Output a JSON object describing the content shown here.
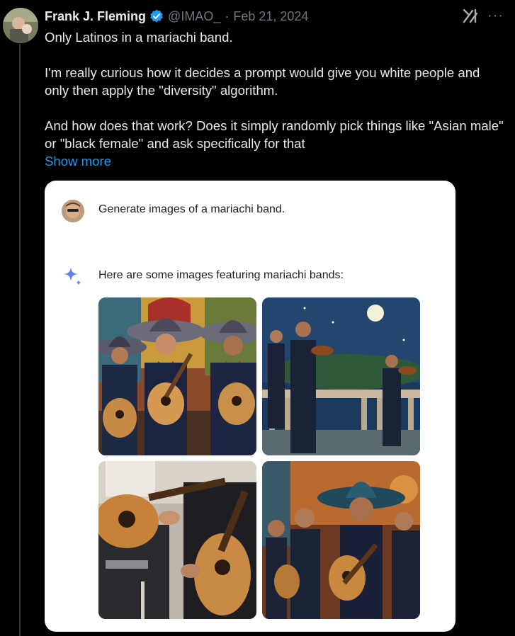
{
  "tweet": {
    "author_name": "Frank J. Fleming",
    "handle": "@IMAO_",
    "separator": "·",
    "date": "Feb 21, 2024",
    "paragraphs": [
      "Only Latinos in a mariachi band.",
      "I'm really curious how it decides a prompt would give you white people and only then apply the \"diversity\" algorithm.",
      "And how does that work? Does it simply randomly pick things like \"Asian male\" or \"black female\" and ask specifically for that"
    ],
    "show_more": "Show more",
    "more_icon": "···",
    "colors": {
      "background": "#000000",
      "link": "#1d9bf0",
      "muted": "#71767b",
      "verified": "#1d9bf0"
    }
  },
  "embedded": {
    "prompt": "Generate images of a mariachi band.",
    "reply": "Here are some images featuring mariachi bands:",
    "images": [
      {
        "icon": "mariachi-trio-image"
      },
      {
        "icon": "mariachi-night-balcony-image"
      },
      {
        "icon": "guitar-closeup-image"
      },
      {
        "icon": "mariachi-group-sombrero-image"
      }
    ]
  }
}
